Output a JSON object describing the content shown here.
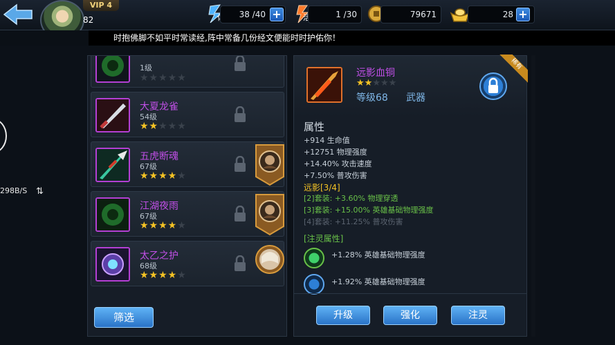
{
  "header": {
    "vip_label": "VIP 4",
    "player_level": "82",
    "stamina_label": "体",
    "stamina_value": "38 /40",
    "energy_label": "活",
    "energy_value": "1 /30",
    "coins_value": "79671",
    "gold_value": "28"
  },
  "ticker": {
    "text": "时抱佛脚不如平时常读经,阵中常备几份经文便能时时护佑你！"
  },
  "overlay": {
    "net_speed": "298B/S"
  },
  "equipment_list": {
    "items": [
      {
        "name": "",
        "level": "1级",
        "stars": 0
      },
      {
        "name": "大夏龙雀",
        "level": "54级",
        "stars": 2
      },
      {
        "name": "五虎断魂",
        "level": "67级",
        "stars": 4
      },
      {
        "name": "江湖夜雨",
        "level": "67级",
        "stars": 4
      },
      {
        "name": "太乙之护",
        "level": "68级",
        "stars": 4
      }
    ],
    "filter_label": "筛选"
  },
  "detail": {
    "name": "远影血铜",
    "stars": 2,
    "level_label": "等级68",
    "type_label": "武器",
    "corner_tag": "稀有",
    "attributes_title": "属性",
    "attributes": [
      "+914 生命值",
      "+12751 物理强度",
      "+14.40% 攻击速度",
      "+7.50% 普攻伤害"
    ],
    "set_title": "远影[3/4]",
    "set_bonuses": [
      {
        "text": "[2]套装: +3.60% 物理穿透",
        "active": true
      },
      {
        "text": "[3]套装: +15.00% 英雄基础物理强度",
        "active": true
      },
      {
        "text": "[4]套装: +11.25% 普攻伤害",
        "active": false
      }
    ],
    "spirit_title": "[注灵属性]",
    "spirit_bonuses": [
      "+1.28% 英雄基础物理强度",
      "+1.92% 英雄基础物理强度"
    ],
    "buttons": {
      "upgrade": "升级",
      "enhance": "强化",
      "infuse": "注灵"
    }
  },
  "colors": {
    "accent_blue": "#2a73c7",
    "rarity_purple": "#c04fe6",
    "star_gold": "#f5c324",
    "set_green": "#69c148"
  }
}
